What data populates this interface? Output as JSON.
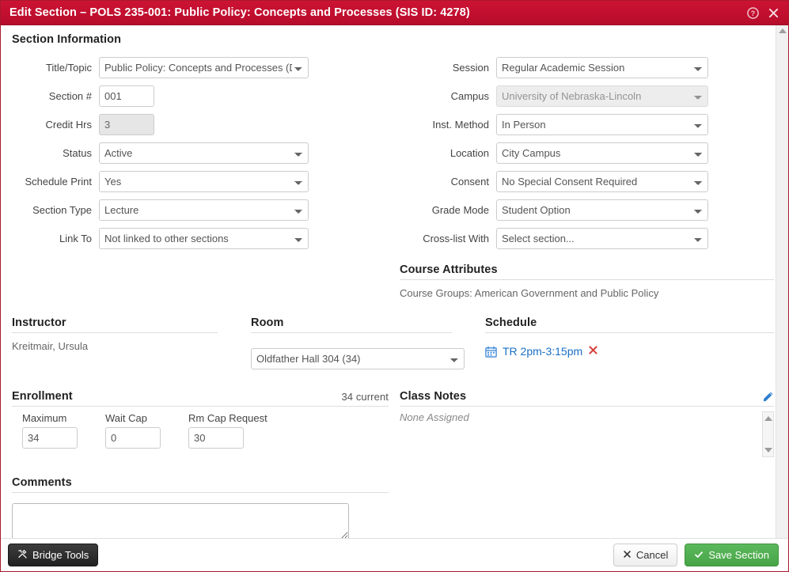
{
  "titlebar": {
    "title": "Edit Section – POLS 235-001: Public Policy: Concepts and Processes (SIS ID: 4278)",
    "help_icon": "question-circle-icon",
    "close_icon": "close-icon",
    "bg_color": "#c20f2f"
  },
  "section_information": {
    "heading": "Section Information",
    "left_fields": [
      {
        "label": "Title/Topic",
        "value": "Public Policy: Concepts and Processes (D",
        "type": "select",
        "disabled": false,
        "width": "w265"
      },
      {
        "label": "Section #",
        "value": "001",
        "type": "input",
        "disabled": false,
        "width": "w70"
      },
      {
        "label": "Credit Hrs",
        "value": "3",
        "type": "input",
        "disabled": true,
        "width": "w70"
      },
      {
        "label": "Status",
        "value": "Active",
        "type": "select",
        "disabled": false,
        "width": "w265"
      },
      {
        "label": "Schedule Print",
        "value": "Yes",
        "type": "select",
        "disabled": false,
        "width": "w265"
      },
      {
        "label": "Section Type",
        "value": "Lecture",
        "type": "select",
        "disabled": false,
        "width": "w265"
      },
      {
        "label": "Link To",
        "value": "Not linked to other sections",
        "type": "select",
        "disabled": false,
        "width": "w265"
      }
    ],
    "right_fields": [
      {
        "label": "Session",
        "value": "Regular Academic Session",
        "type": "select",
        "disabled": false,
        "width": "w268"
      },
      {
        "label": "Campus",
        "value": "University of Nebraska-Lincoln",
        "type": "select",
        "disabled": true,
        "width": "w268"
      },
      {
        "label": "Inst. Method",
        "value": "In Person",
        "type": "select",
        "disabled": false,
        "width": "w268"
      },
      {
        "label": "Location",
        "value": "City Campus",
        "type": "select",
        "disabled": false,
        "width": "w268"
      },
      {
        "label": "Consent",
        "value": "No Special Consent Required",
        "type": "select",
        "disabled": false,
        "width": "w268"
      },
      {
        "label": "Grade Mode",
        "value": "Student Option",
        "type": "select",
        "disabled": false,
        "width": "w268"
      },
      {
        "label": "Cross-list With",
        "value": "Select section...",
        "type": "select",
        "disabled": false,
        "width": "w268"
      }
    ]
  },
  "course_attributes": {
    "heading": "Course Attributes",
    "text": "Course Groups: American Government and Public Policy"
  },
  "instructor": {
    "heading": "Instructor",
    "name": "Kreitmair, Ursula"
  },
  "room": {
    "heading": "Room",
    "value": "Oldfather Hall 304 (34)"
  },
  "schedule": {
    "heading": "Schedule",
    "calendar_icon": "calendar-icon",
    "meeting": "TR 2pm-3:15pm",
    "remove_icon": "remove-meeting-icon",
    "link_color": "#1a6fc4",
    "remove_color": "#d43f3a"
  },
  "enrollment": {
    "heading": "Enrollment",
    "current": "34 current",
    "fields": [
      {
        "label": "Maximum",
        "value": "34"
      },
      {
        "label": "Wait Cap",
        "value": "0"
      },
      {
        "label": "Rm Cap Request",
        "value": "30"
      }
    ]
  },
  "class_notes": {
    "heading": "Class Notes",
    "edit_icon": "pencil-edit-icon",
    "text": "None Assigned",
    "scroll_up_icon": "scroll-up-arrow-icon",
    "scroll_down_icon": "scroll-down-arrow-icon"
  },
  "comments": {
    "heading": "Comments",
    "value": "",
    "placeholder": ""
  },
  "footer": {
    "bridge_tools_label": "Bridge Tools",
    "bridge_tools_icon": "tools-icon",
    "cancel_label": "Cancel",
    "cancel_icon": "x-mark-icon",
    "save_label": "Save Section",
    "save_icon": "check-mark-icon",
    "save_color": "#4caf50"
  }
}
